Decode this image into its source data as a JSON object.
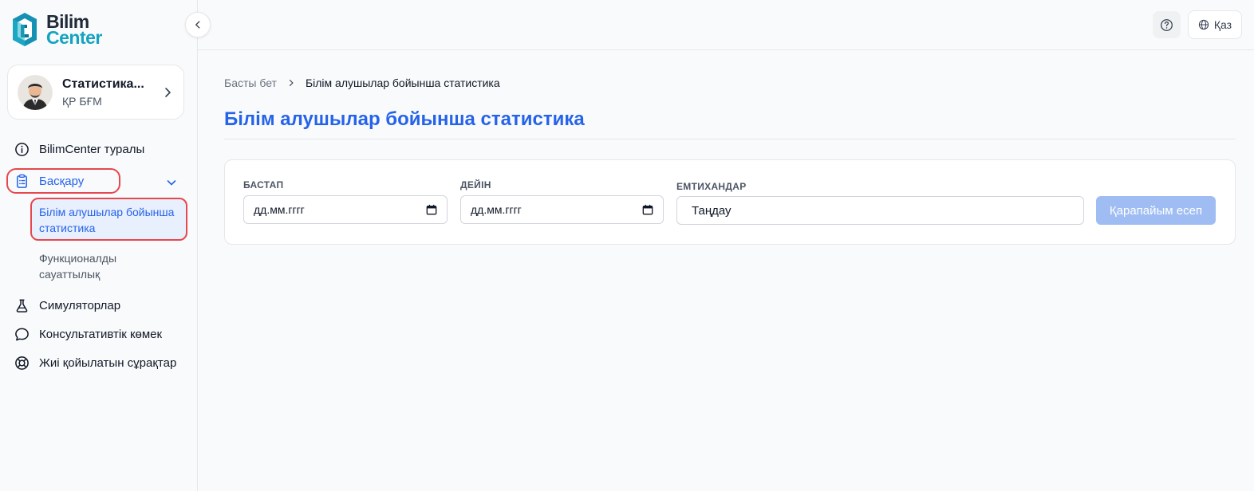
{
  "brand": {
    "line1": "Bilim",
    "line2": "Center"
  },
  "profile": {
    "name": "Статистика...",
    "org": "ҚР БҒМ"
  },
  "nav": {
    "about": "BilimCenter туралы",
    "management": "Басқару",
    "sub_items": [
      "Білім алушылар бойынша статистика",
      "Функционалды сауаттылық"
    ],
    "simulators": "Симуляторлар",
    "consult": "Консультативтік көмек",
    "faq": "Жиі қойылатын сұрақтар"
  },
  "topbar": {
    "lang_label": "Қаз"
  },
  "breadcrumb": {
    "home": "Басты бет",
    "current": "Білім алушылар бойынша статистика"
  },
  "page": {
    "title": "Білім алушылар бойынша статистика"
  },
  "filters": {
    "from_label": "БАСТАП",
    "from_value": "дд.мм.гггг",
    "to_label": "ДЕЙІН",
    "to_value": "дд.мм.гггг",
    "exams_label": "ЕМТИХАНДАР",
    "exams_value": "Таңдау",
    "submit_label": "Қарапайым есеп"
  },
  "colors": {
    "primary": "#2563eb",
    "highlight": "#e5484d",
    "brand_teal": "#14a3c0",
    "button_disabled": "#9fbdf3"
  }
}
